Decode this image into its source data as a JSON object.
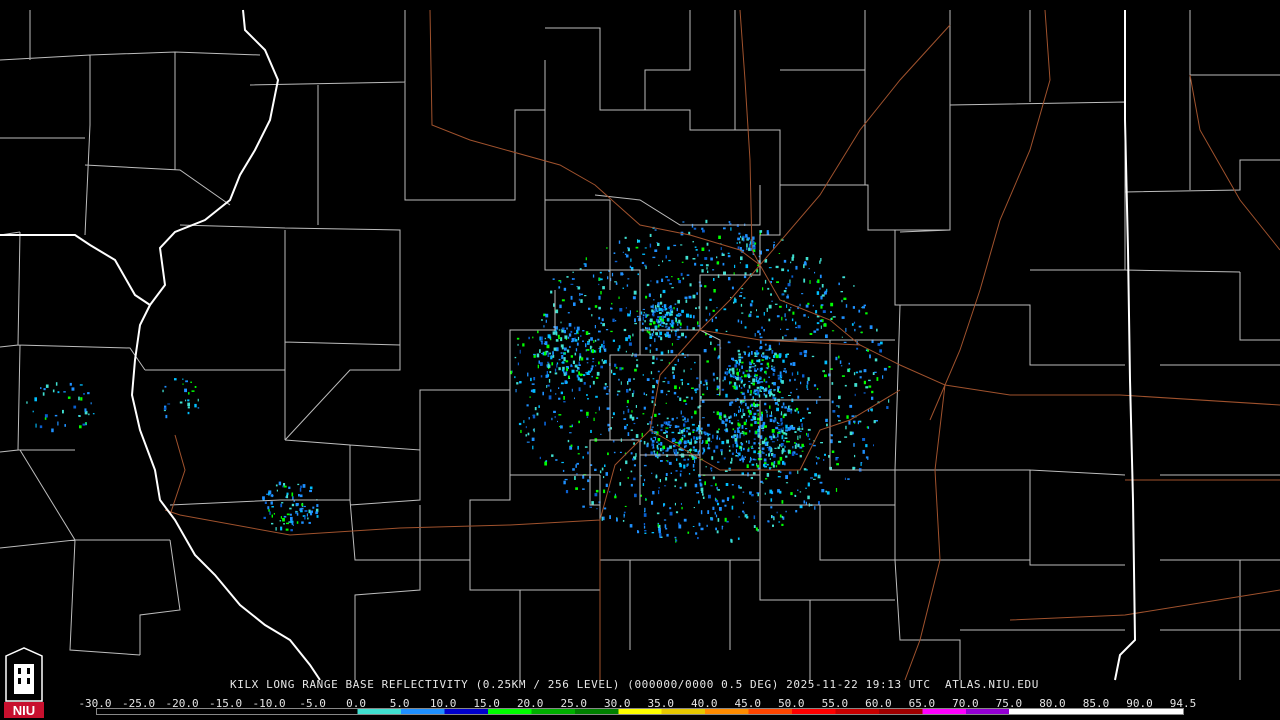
{
  "caption": "KILX LONG RANGE BASE REFLECTIVITY (0.25KM / 256 LEVEL) (000000/0000 0.5 DEG) 2025-11-22 19:13 UTC  ATLAS.NIU.EDU",
  "logo_text": "NIU",
  "colors": {
    "background": "#000000",
    "county_lines": "#bdbdbd",
    "state_lines": "#ffffff",
    "roads": "#a0522d"
  },
  "scale": {
    "ticks": [
      "-30.0",
      "-25.0",
      "-20.0",
      "-15.0",
      "-10.0",
      "-5.0",
      "0.0",
      "5.0",
      "10.0",
      "15.0",
      "20.0",
      "25.0",
      "30.0",
      "35.0",
      "40.0",
      "45.0",
      "50.0",
      "55.0",
      "60.0",
      "65.0",
      "70.0",
      "75.0",
      "80.0",
      "85.0",
      "90.0",
      "94.5"
    ],
    "colors": [
      "#000000",
      "#000000",
      "#000000",
      "#000000",
      "#000000",
      "#000000",
      "#40e0d0",
      "#1e90ff",
      "#0000cd",
      "#00ff00",
      "#00b000",
      "#008000",
      "#ffff00",
      "#e6c800",
      "#ff8c00",
      "#ff4500",
      "#ff0000",
      "#c80000",
      "#a00000",
      "#ff00ff",
      "#9400d3",
      "#ffffff",
      "#ffffff",
      "#ffffff",
      "#ffffff"
    ]
  }
}
